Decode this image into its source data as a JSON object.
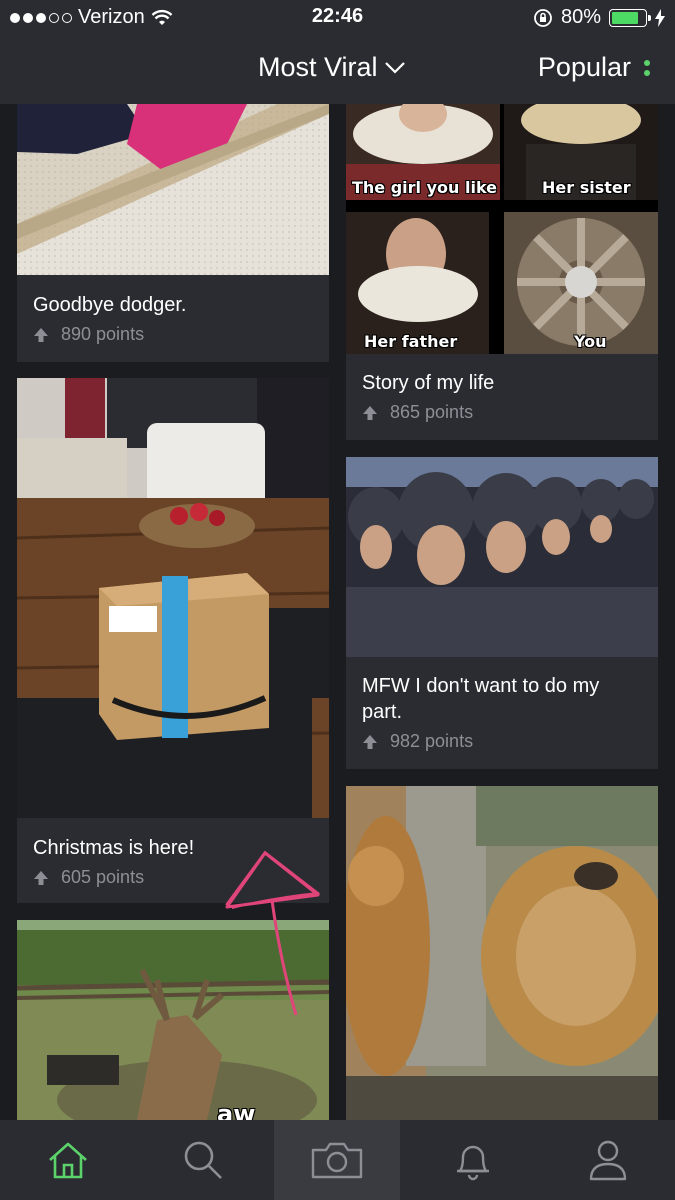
{
  "status_bar": {
    "carrier": "Verizon",
    "time": "22:46",
    "battery": "80%",
    "battery_level": 0.8,
    "signal_dots_filled": 3,
    "signal_dots_total": 5
  },
  "nav": {
    "title": "Most Viral",
    "sort": "Popular"
  },
  "feed": {
    "left": [
      {
        "title": "Goodbye dodger.",
        "points": "890 points"
      },
      {
        "title": "Christmas is here!",
        "points": "605 points"
      },
      {
        "caption": "aw yissss"
      }
    ],
    "right": [
      {
        "title": "Story of my life",
        "points": "865 points",
        "panels": [
          "The girl you like",
          "Her sister",
          "Her father",
          "You"
        ]
      },
      {
        "title": "MFW I don't want to do my part.",
        "points": "982 points"
      },
      {}
    ]
  },
  "tabs": [
    "home-icon",
    "search-icon",
    "camera-icon",
    "bell-icon",
    "user-icon"
  ],
  "colors": {
    "background": "#1b1c20",
    "card": "#2b2c31",
    "muted_text": "#8d8f96",
    "accent_green": "#5bd26a",
    "annotation_pink": "#e0457a"
  }
}
